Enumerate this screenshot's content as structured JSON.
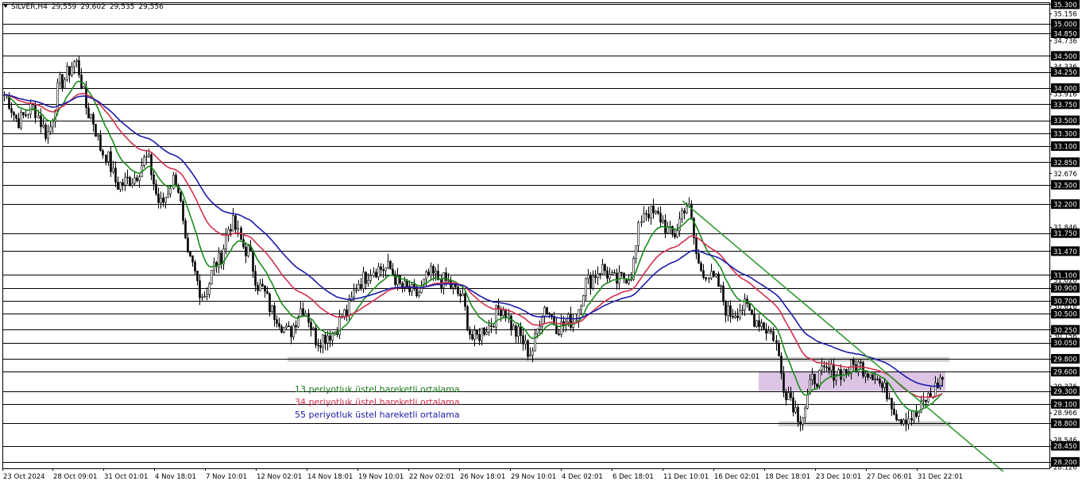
{
  "header": {
    "symbol": "SILVER,H4",
    "values": [
      "29,559",
      "29,602",
      "29,535",
      "29,556"
    ]
  },
  "legend": [
    {
      "label": "13 periyotluk üstel hareketli ortalama",
      "color": "#1a7a1a"
    },
    {
      "label": "34 periyotluk üstel hareketli ortalama",
      "color": "#d1304e"
    },
    {
      "label": "55 periyotluk üstel hareketli ortalama",
      "color": "#1a1aa6"
    }
  ],
  "colors": {
    "ema13": "#1a8a1a",
    "ema34": "#d1304e",
    "ema55": "#1a1aa6",
    "trendline": "#2f9a2f",
    "zone_fill": "#c9a6d6",
    "support_line": "#c8c8c8"
  },
  "chart_data": {
    "type": "candlestick",
    "symbol": "SILVER",
    "timeframe": "H4",
    "ylim": [
      28.1,
      35.33
    ],
    "y_ticks": [
      "35.300",
      "35.156",
      "35.000",
      "34.850",
      "34.736",
      "34.500",
      "34.336",
      "34.250",
      "34.000",
      "33.916",
      "33.750",
      "33.500",
      "33.300",
      "33.100",
      "32.850",
      "32.676",
      "32.500",
      "32.200",
      "31.846",
      "31.750",
      "31.470",
      "31.100",
      "31.026",
      "30.900",
      "30.700",
      "30.616",
      "30.500",
      "30.250",
      "30.156",
      "30.050",
      "29.800",
      "29.600",
      "29.376",
      "29.300",
      "29.100",
      "28.966",
      "28.800",
      "28.546",
      "28.450",
      "28.200",
      "28.126"
    ],
    "x_labels": [
      "23 Oct 2024",
      "28 Oct 09:01",
      "31 Oct 01:01",
      "4 Nov 18:01",
      "7 Nov 10:01",
      "12 Nov 02:01",
      "14 Nov 18:01",
      "19 Nov 10:01",
      "22 Nov 02:01",
      "26 Nov 18:01",
      "29 Nov 10:01",
      "4 Dec 02:01",
      "6 Dec 18:01",
      "11 Dec 10:01",
      "16 Dec 02:01",
      "18 Dec 18:01",
      "23 Dec 10:01",
      "27 Dec 06:01",
      "31 Dec 22:01"
    ],
    "horizontal_levels": [
      35.3,
      35.0,
      34.85,
      34.5,
      34.25,
      34.0,
      33.75,
      33.5,
      33.3,
      33.1,
      32.85,
      32.5,
      32.2,
      31.75,
      31.47,
      31.1,
      30.9,
      30.7,
      30.5,
      30.25,
      30.05,
      29.8,
      29.6,
      29.3,
      29.1,
      28.8,
      28.45,
      28.2
    ],
    "anchor_prices": [
      33.9,
      33.5,
      33.7,
      33.3,
      34.1,
      34.4,
      33.6,
      33.0,
      32.5,
      32.6,
      32.9,
      32.2,
      32.6,
      31.3,
      30.8,
      31.3,
      31.9,
      31.5,
      30.9,
      30.5,
      30.2,
      30.6,
      30.1,
      30.2,
      30.5,
      31.0,
      31.2,
      31.2,
      30.9,
      30.8,
      31.1,
      31.0,
      30.8,
      30.1,
      30.3,
      30.6,
      30.2,
      29.9,
      30.6,
      30.3,
      30.4,
      31.0,
      31.2,
      31.0,
      31.1,
      32.1,
      32.0,
      31.7,
      32.2,
      31.2,
      31.0,
      30.5,
      30.6,
      30.4,
      30.2,
      29.3,
      28.9,
      29.5,
      29.6,
      29.6,
      29.7,
      29.6,
      29.3,
      28.9,
      28.9,
      29.2,
      29.5
    ]
  }
}
